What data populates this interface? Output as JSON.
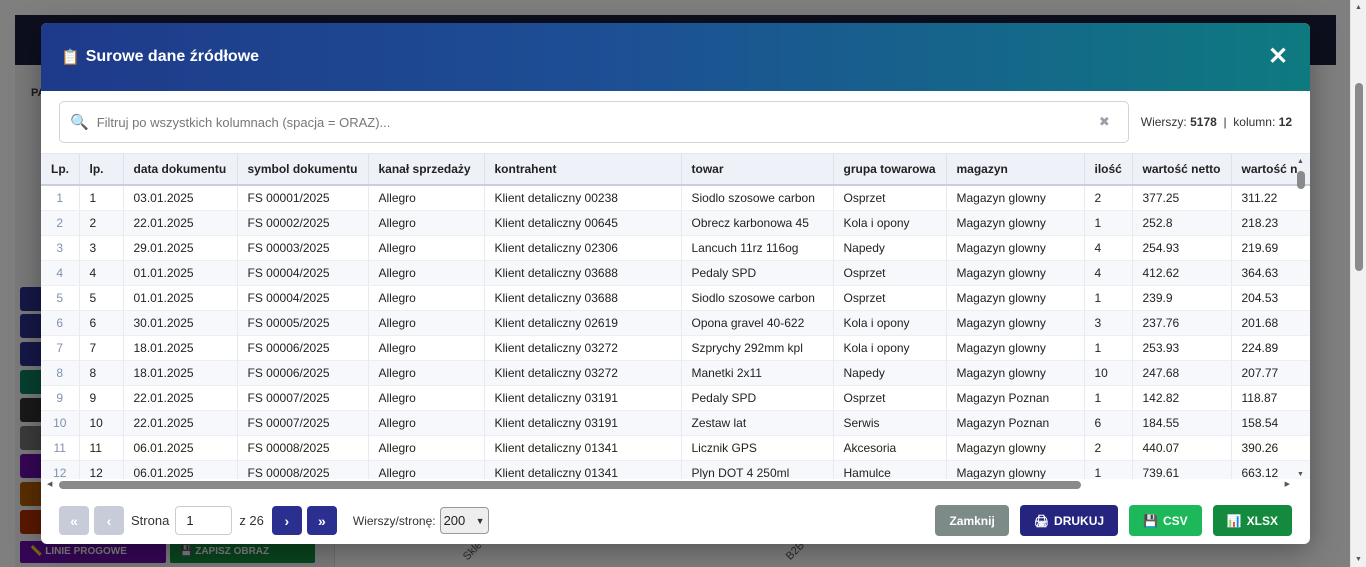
{
  "background": {
    "pills": [
      "📏 LINIE PROGOWE",
      "💾 ZAPISZ OBRAZ"
    ],
    "side_text": [
      "PA"
    ],
    "axis_labels": [
      "Skle",
      "B2B"
    ]
  },
  "modal": {
    "title": "Surowe dane źródłowe",
    "title_icon": "📋",
    "close_icon": "✕"
  },
  "filter": {
    "placeholder": "Filtruj po wszystkich kolumnach (spacja = ORAZ)...",
    "value": "",
    "search_icon": "🔍",
    "clear_icon": "✖"
  },
  "stats": {
    "rows_label": "Wierszy:",
    "rows_value": "5178",
    "separator": "|",
    "cols_label": "kolumn:",
    "cols_value": "12"
  },
  "table": {
    "columns": [
      "Lp.",
      "lp.",
      "data dokumentu",
      "symbol dokumentu",
      "kanał sprzedaży",
      "kontrahent",
      "towar",
      "grupa towarowa",
      "magazyn",
      "ilość",
      "wartość netto",
      "wartość n"
    ],
    "rows": [
      [
        "1",
        "1",
        "03.01.2025",
        "FS 00001/2025",
        "Allegro",
        "Klient detaliczny 00238",
        "Siodlo szosowe carbon",
        "Osprzet",
        "Magazyn glowny",
        "2",
        "377.25",
        "311.22"
      ],
      [
        "2",
        "2",
        "22.01.2025",
        "FS 00002/2025",
        "Allegro",
        "Klient detaliczny 00645",
        "Obrecz karbonowa 45",
        "Kola i opony",
        "Magazyn glowny",
        "1",
        "252.8",
        "218.23"
      ],
      [
        "3",
        "3",
        "29.01.2025",
        "FS 00003/2025",
        "Allegro",
        "Klient detaliczny 02306",
        "Lancuch 11rz 116og",
        "Napedy",
        "Magazyn glowny",
        "4",
        "254.93",
        "219.69"
      ],
      [
        "4",
        "4",
        "01.01.2025",
        "FS 00004/2025",
        "Allegro",
        "Klient detaliczny 03688",
        "Pedaly SPD",
        "Osprzet",
        "Magazyn glowny",
        "4",
        "412.62",
        "364.63"
      ],
      [
        "5",
        "5",
        "01.01.2025",
        "FS 00004/2025",
        "Allegro",
        "Klient detaliczny 03688",
        "Siodlo szosowe carbon",
        "Osprzet",
        "Magazyn glowny",
        "1",
        "239.9",
        "204.53"
      ],
      [
        "6",
        "6",
        "30.01.2025",
        "FS 00005/2025",
        "Allegro",
        "Klient detaliczny 02619",
        "Opona gravel 40-622",
        "Kola i opony",
        "Magazyn glowny",
        "3",
        "237.76",
        "201.68"
      ],
      [
        "7",
        "7",
        "18.01.2025",
        "FS 00006/2025",
        "Allegro",
        "Klient detaliczny 03272",
        "Szprychy 292mm kpl",
        "Kola i opony",
        "Magazyn glowny",
        "1",
        "253.93",
        "224.89"
      ],
      [
        "8",
        "8",
        "18.01.2025",
        "FS 00006/2025",
        "Allegro",
        "Klient detaliczny 03272",
        "Manetki 2x11",
        "Napedy",
        "Magazyn glowny",
        "10",
        "247.68",
        "207.77"
      ],
      [
        "9",
        "9",
        "22.01.2025",
        "FS 00007/2025",
        "Allegro",
        "Klient detaliczny 03191",
        "Pedaly SPD",
        "Osprzet",
        "Magazyn Poznan",
        "1",
        "142.82",
        "118.87"
      ],
      [
        "10",
        "10",
        "22.01.2025",
        "FS 00007/2025",
        "Allegro",
        "Klient detaliczny 03191",
        "Zestaw lat",
        "Serwis",
        "Magazyn Poznan",
        "6",
        "184.55",
        "158.54"
      ],
      [
        "11",
        "11",
        "06.01.2025",
        "FS 00008/2025",
        "Allegro",
        "Klient detaliczny 01341",
        "Licznik GPS",
        "Akcesoria",
        "Magazyn glowny",
        "2",
        "440.07",
        "390.26"
      ],
      [
        "12",
        "12",
        "06.01.2025",
        "FS 00008/2025",
        "Allegro",
        "Klient detaliczny 01341",
        "Plyn DOT 4 250ml",
        "Hamulce",
        "Magazyn glowny",
        "1",
        "739.61",
        "663.12"
      ]
    ]
  },
  "pagination": {
    "first": "«",
    "prev": "‹",
    "page_label": "Strona",
    "page_value": "1",
    "of_label": "z 26",
    "next": "›",
    "last": "»",
    "rows_per_page_label": "Wierszy/stronę:",
    "rows_per_page_value": "200"
  },
  "actions": {
    "close_label": "Zamknij",
    "print_label": "DRUKUJ",
    "print_icon": "🖨",
    "csv_label": "CSV",
    "csv_icon": "💾",
    "xlsx_label": "XLSX",
    "xlsx_icon": "📊"
  },
  "colors": {
    "header_gradient_start": "#1e3a8a",
    "header_gradient_end": "#0e7a80",
    "print_button": "#25257f",
    "csv_button": "#1cb85a",
    "xlsx_button": "#138a3e",
    "close_button": "#7c8a88",
    "pagination_active": "#2b2f8f"
  }
}
